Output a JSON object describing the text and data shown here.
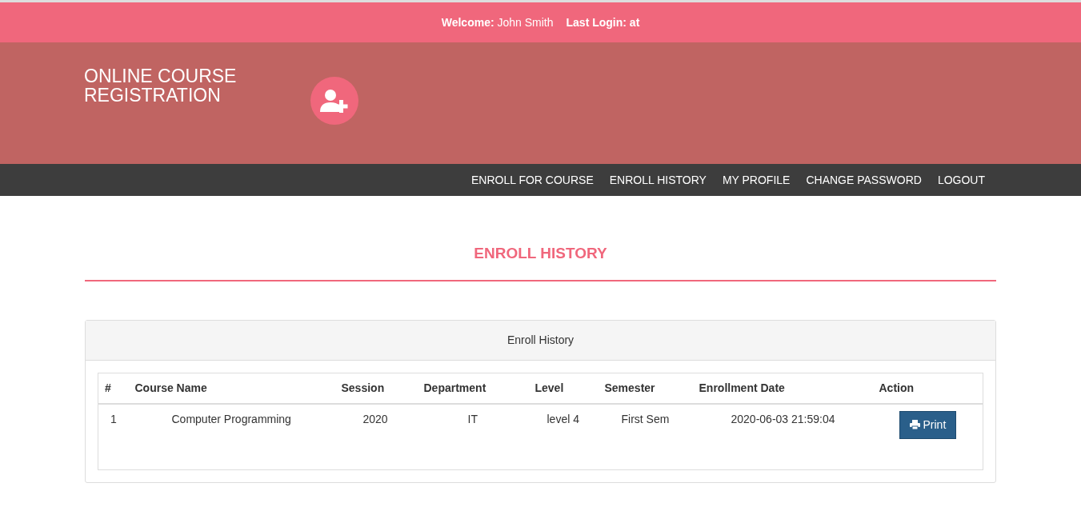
{
  "top_bar": {
    "welcome_label": "Welcome:",
    "user": "John Smith",
    "last_login_label": "Last Login:",
    "last_login_value": "at"
  },
  "header": {
    "title_line_1": "ONLINE COURSE",
    "title_line_2": "REGISTRATION"
  },
  "nav": [
    {
      "label": "ENROLL FOR COURSE"
    },
    {
      "label": "ENROLL HISTORY"
    },
    {
      "label": "MY PROFILE"
    },
    {
      "label": "CHANGE PASSWORD"
    },
    {
      "label": "LOGOUT"
    }
  ],
  "page_title": "ENROLL HISTORY",
  "panel": {
    "heading": "Enroll History",
    "table": {
      "columns": [
        "#",
        "Course Name",
        "Session",
        "Department",
        "Level",
        "Semester",
        "Enrollment Date",
        "Action"
      ],
      "rows": [
        {
          "cells": [
            "1",
            "Computer Programming",
            "2020",
            "IT",
            "level 4",
            "First Sem",
            "2020-06-03 21:59:04"
          ],
          "action": "Print"
        }
      ]
    }
  }
}
